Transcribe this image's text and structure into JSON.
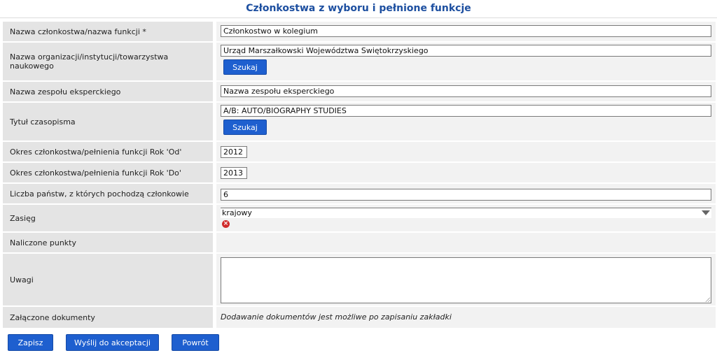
{
  "page_title": "Członkostwa z wyboru i pełnione funkcje",
  "fields": {
    "membership_name": {
      "label": "Nazwa członkostwa/nazwa funkcji *",
      "value": "Członkostwo w kolegium"
    },
    "organization": {
      "label": "Nazwa organizacji/instytucji/towarzystwa naukowego",
      "value": "Urząd Marszałkowski Województwa Swiętokrzyskiego",
      "search_label": "Szukaj"
    },
    "expert_team": {
      "label": "Nazwa zespołu eksperckiego",
      "value": "Nazwa zespołu eksperckiego"
    },
    "journal_title": {
      "label": "Tytuł czasopisma",
      "value": "A/B: AUTO/BIOGRAPHY STUDIES",
      "search_label": "Szukaj"
    },
    "year_from": {
      "label": "Okres członkostwa/pełnienia funkcji Rok 'Od'",
      "value": "2012"
    },
    "year_to": {
      "label": "Okres członkostwa/pełnienia funkcji Rok 'Do'",
      "value": "2013"
    },
    "countries_count": {
      "label": "Liczba państw, z których pochodzą członkowie",
      "value": "6"
    },
    "scope": {
      "label": "Zasięg",
      "value": "krajowy"
    },
    "points": {
      "label": "Naliczone punkty",
      "value": ""
    },
    "remarks": {
      "label": "Uwagi",
      "value": ""
    },
    "attachments": {
      "label": "Załączone dokumenty",
      "note": "Dodawanie dokumentów jest możliwe po zapisaniu zakładki"
    }
  },
  "actions": {
    "save": "Zapisz",
    "send": "Wyślij do akceptacji",
    "back": "Powrót"
  },
  "colors": {
    "title": "#1d4fa0",
    "button": "#1e5fcf",
    "label_bg": "#e4e4e4",
    "value_bg": "#f2f2f2",
    "clear_icon": "#d02b2b"
  },
  "icons": {
    "dropdown": "chevron-down-icon",
    "clear": "clear-icon",
    "resize": "resize-grip-icon"
  }
}
